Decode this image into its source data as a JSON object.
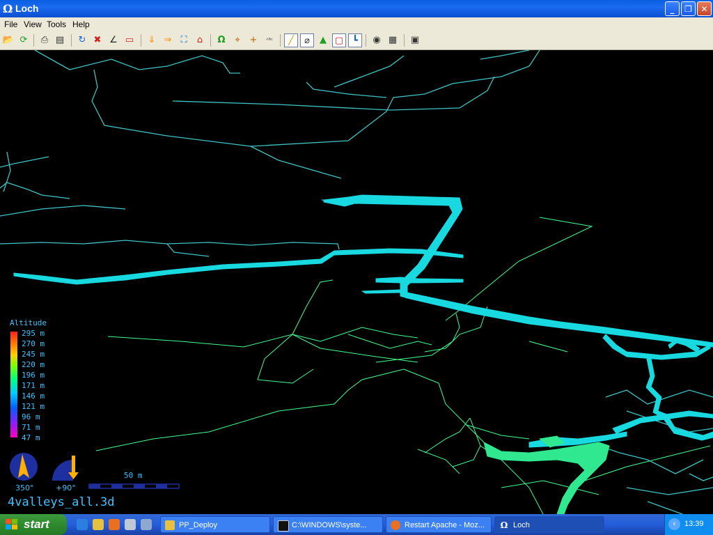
{
  "window": {
    "title": "Loch",
    "app_icon": "omega-icon"
  },
  "menu": [
    "File",
    "View",
    "Tools",
    "Help"
  ],
  "toolbar": {
    "icons": [
      "open-file-icon",
      "refresh-icon",
      "print-icon",
      "print-preview-icon",
      "rotate-icon",
      "cancel-rotate-icon",
      "tilt-icon",
      "view-3d-icon",
      "down-arrow-icon",
      "right-arrow-icon",
      "fit-view-icon",
      "home-icon",
      "omega-icon",
      "crosshair-icon",
      "plus-icon",
      "text-label-icon",
      "centreline-icon",
      "passage-tubes-icon",
      "surface-icon",
      "bounding-box-icon",
      "axes-icon",
      "recording-icon",
      "log-icon",
      "fullscreen-icon"
    ]
  },
  "legend": {
    "title": "Altitude",
    "labels": [
      "295 m",
      "270 m",
      "245 m",
      "220 m",
      "196 m",
      "171 m",
      "146 m",
      "121 m",
      "96 m",
      "71 m",
      "47 m"
    ]
  },
  "compass": {
    "bearing": "350°",
    "tilt": "+90°"
  },
  "scale": {
    "label": "50 m"
  },
  "filename": "4valleys_all.3d",
  "colors": {
    "centreline": "#3ec4c4",
    "surface_leg": "#40ff90",
    "tube_cyan": "#19d9e0",
    "tube_green": "#30e890",
    "hud_text": "#3ec4ff"
  },
  "taskbar": {
    "start_label": "start",
    "tasks": [
      {
        "label": "PP_Deploy",
        "icon": "folder-icon"
      },
      {
        "label": "C:\\WINDOWS\\syste...",
        "icon": "command-prompt-icon"
      },
      {
        "label": "Restart Apache - Moz...",
        "icon": "firefox-icon"
      },
      {
        "label": "Loch",
        "icon": "omega-icon",
        "active": true
      }
    ],
    "clock": "13:39"
  }
}
